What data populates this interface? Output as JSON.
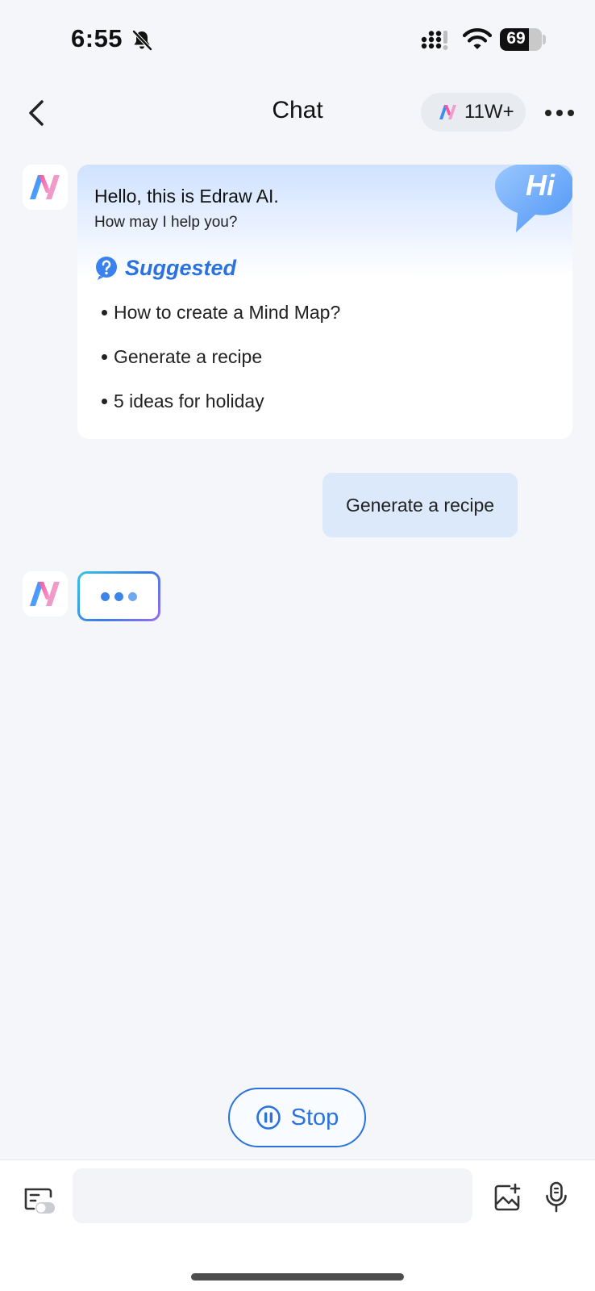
{
  "status_bar": {
    "time": "6:55",
    "battery": "69",
    "battery_level": 0.69
  },
  "header": {
    "title": "Chat",
    "credits": "11W+"
  },
  "welcome": {
    "greeting": "Hello, this is Edraw AI.",
    "subgreeting": "How may I help you?",
    "hi_badge": "Hi",
    "suggested_title": "Suggested",
    "suggestions": [
      "How to create a Mind Map?",
      "Generate a recipe",
      "5 ideas for holiday"
    ]
  },
  "messages": {
    "user_message": "Generate a recipe"
  },
  "controls": {
    "stop_label": "Stop",
    "input_value": "",
    "input_placeholder": ""
  },
  "colors": {
    "accent": "#2a72e0",
    "background": "#f4f6f9",
    "user_bubble": "#dce9fa"
  }
}
